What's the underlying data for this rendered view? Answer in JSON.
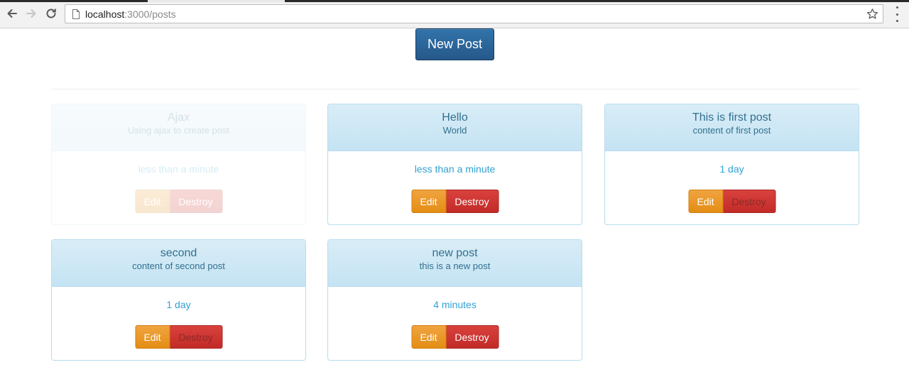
{
  "browser": {
    "url_host": "localhost",
    "url_path": ":3000/posts",
    "icons": {
      "back": "back-arrow-icon",
      "forward": "forward-arrow-icon",
      "reload": "reload-icon",
      "page": "page-icon",
      "bookmark": "star-icon",
      "menu": "more-vert-icon"
    }
  },
  "page": {
    "new_post_label": "New Post"
  },
  "colors": {
    "primary": "#2d6ca2",
    "card_border": "#b9dcee",
    "card_head": "#d9edf7",
    "text_info": "#31708f",
    "time": "#31a2d2",
    "warning": "#e38d14",
    "danger": "#c9302c"
  },
  "posts": [
    {
      "title": "Ajax",
      "content": "Using ajax to create post",
      "time": "less than a minute",
      "edit_label": "Edit",
      "destroy_label": "Destroy",
      "faded": true
    },
    {
      "title": "Hello",
      "content": "World",
      "time": "less than a minute",
      "edit_label": "Edit",
      "destroy_label": "Destroy"
    },
    {
      "title": "This is first post",
      "content": "content of first post",
      "time": "1 day",
      "edit_label": "Edit",
      "destroy_label": "Destroy"
    },
    {
      "title": "second",
      "content": "content of second post",
      "time": "1 day",
      "edit_label": "Edit",
      "destroy_label": "Destroy"
    },
    {
      "title": "new post",
      "content": "this is a new post",
      "time": "4 minutes",
      "edit_label": "Edit",
      "destroy_label": "Destroy"
    }
  ]
}
